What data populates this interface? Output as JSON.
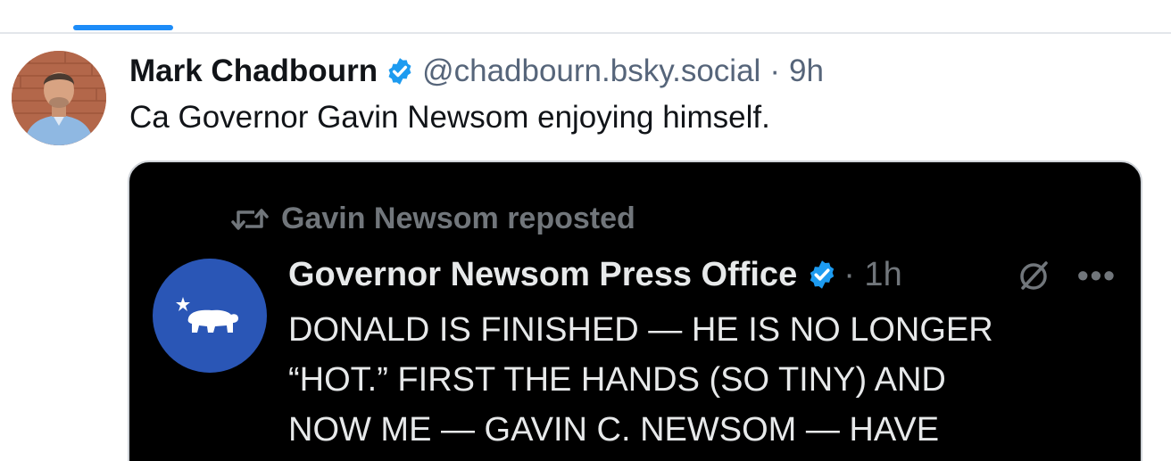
{
  "post": {
    "author_name": "Mark Chadbourn",
    "handle": "@chadbourn.bsky.social",
    "separator": "·",
    "time": "9h",
    "text": "Ca Governor Gavin Newsom enjoying himself."
  },
  "embed": {
    "repost_label": "Gavin Newsom reposted",
    "author_name": "Governor Newsom Press Office",
    "time": "· 1h",
    "text": "DONALD IS FINISHED — HE IS NO LONGER\n“HOT.” FIRST THE HANDS (SO TINY) AND\nNOW ME — GAVIN C. NEWSOM — HAVE"
  },
  "colors": {
    "accent": "#1d8cf8",
    "verified_blue": "#1d9bf0",
    "embed_background": "#000000",
    "ca_avatar_blue": "#2a56b6"
  },
  "icons": {
    "verified": "verified-check-icon",
    "repost": "repost-icon",
    "grok": "grok-icon",
    "more": "more-icon"
  }
}
